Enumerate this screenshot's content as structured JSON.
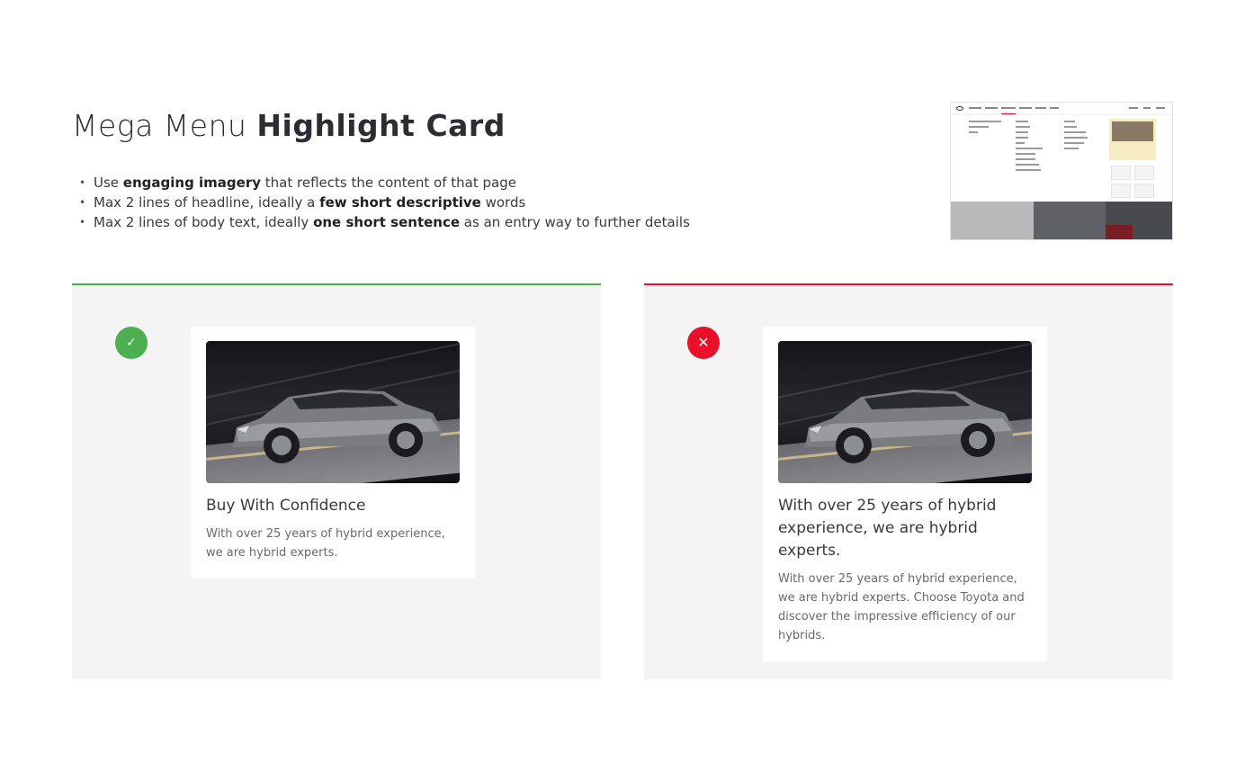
{
  "title": {
    "light": "Mega Menu ",
    "bold": "Highlight Card"
  },
  "guidelines": [
    {
      "pre": "Use ",
      "bold": "engaging imagery",
      "post": " that reflects the content of that page"
    },
    {
      "pre": "Max 2 lines of headline, ideally a ",
      "bold": "few short descriptive",
      "post": " words"
    },
    {
      "pre": "Max 2 lines of body text, ideally ",
      "bold": "one short sentence",
      "post": " as an entry way to further details"
    }
  ],
  "colors": {
    "do": "#4caf50",
    "dont": "#e8102a",
    "panel_bg": "#f4f4f4"
  },
  "icons": {
    "do": "checkmark-icon",
    "dont": "close-icon"
  },
  "do_example": {
    "badge": "✓",
    "headline": "Buy With Confidence",
    "body": "With over 25 years of hybrid experience, we are hybrid experts."
  },
  "dont_example": {
    "badge": "✕",
    "headline": "With over 25 years of hybrid experience, we are hybrid experts.",
    "body": "With over 25 years of hybrid experience, we are hybrid experts. Choose Toyota and discover the impressive efficiency of our hybrids."
  }
}
